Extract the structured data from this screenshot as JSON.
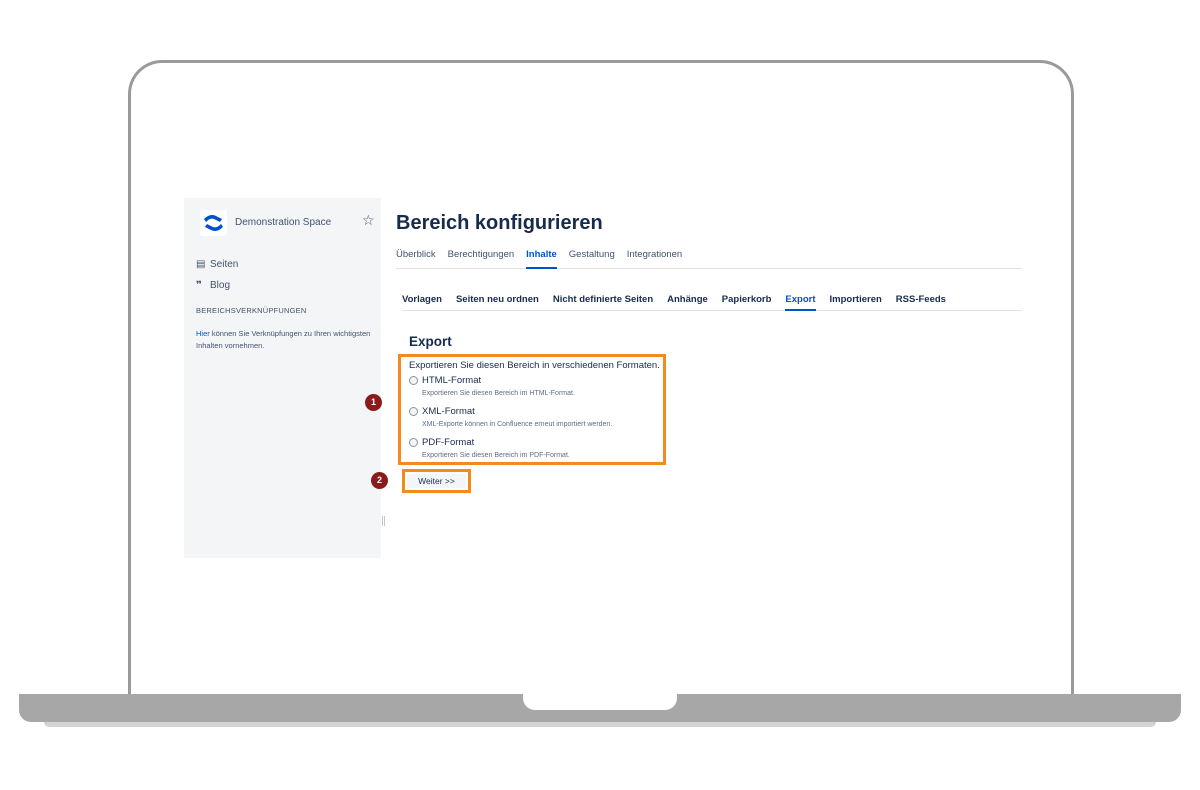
{
  "sidebar": {
    "space_name": "Demonstration Space",
    "links": [
      {
        "icon": "page-icon",
        "label": "Seiten"
      },
      {
        "icon": "quote-icon",
        "label": "Blog"
      }
    ],
    "shortcuts_heading": "BEREICHSVERKNÜPFUNGEN",
    "shortcuts_link": "Hier",
    "shortcuts_text": " können Sie Verknüpfungen zu Ihren wichtigsten Inhalten vornehmen."
  },
  "main": {
    "title": "Bereich konfigurieren",
    "tabs": [
      "Überblick",
      "Berechtigungen",
      "Inhalte",
      "Gestaltung",
      "Integrationen"
    ],
    "active_tab": "Inhalte",
    "subtabs": [
      "Vorlagen",
      "Seiten neu ordnen",
      "Nicht definierte Seiten",
      "Anhänge",
      "Papierkorb",
      "Export",
      "Importieren",
      "RSS-Feeds"
    ],
    "active_subtab": "Export",
    "section_title": "Export",
    "intro": "Exportieren Sie diesen Bereich in verschiedenen Formaten.",
    "options": [
      {
        "label": "HTML-Format",
        "desc": "Exportieren Sie diesen Bereich im HTML-Format."
      },
      {
        "label": "XML-Format",
        "desc": "XML-Exporte können in Confluence erneut importiert werden."
      },
      {
        "label": "PDF-Format",
        "desc": "Exportieren Sie diesen Bereich im PDF-Format."
      }
    ],
    "next_button": "Weiter >>"
  },
  "annotations": {
    "step1": "1",
    "step2": "2",
    "highlight_color": "#f28a1e",
    "badge_color": "#8b1a1a"
  },
  "colors": {
    "accent": "#0052cc",
    "sidebar_bg": "#f4f5f7"
  }
}
